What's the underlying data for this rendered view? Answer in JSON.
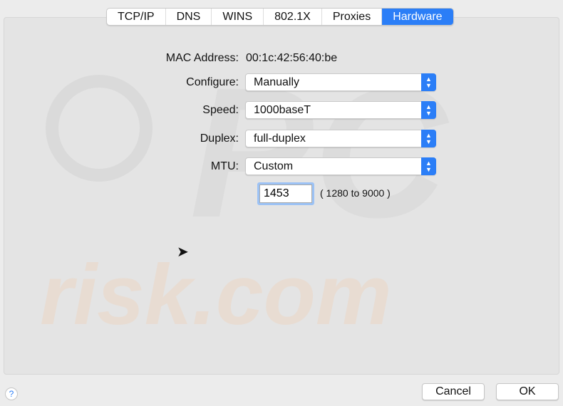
{
  "tabs": [
    {
      "label": "TCP/IP"
    },
    {
      "label": "DNS"
    },
    {
      "label": "WINS"
    },
    {
      "label": "802.1X"
    },
    {
      "label": "Proxies"
    },
    {
      "label": "Hardware",
      "active": true
    }
  ],
  "form": {
    "mac_label": "MAC Address:",
    "mac_value": "00:1c:42:56:40:be",
    "configure_label": "Configure:",
    "configure_value": "Manually",
    "speed_label": "Speed:",
    "speed_value": "1000baseT",
    "duplex_label": "Duplex:",
    "duplex_value": "full-duplex",
    "mtu_label": "MTU:",
    "mtu_value": "Custom",
    "mtu_custom_value": "1453",
    "mtu_range": "( 1280 to 9000 )"
  },
  "buttons": {
    "help": "?",
    "cancel": "Cancel",
    "ok": "OK"
  },
  "watermark": "PCrisk.com",
  "colors": {
    "accent": "#2b7ef7"
  }
}
